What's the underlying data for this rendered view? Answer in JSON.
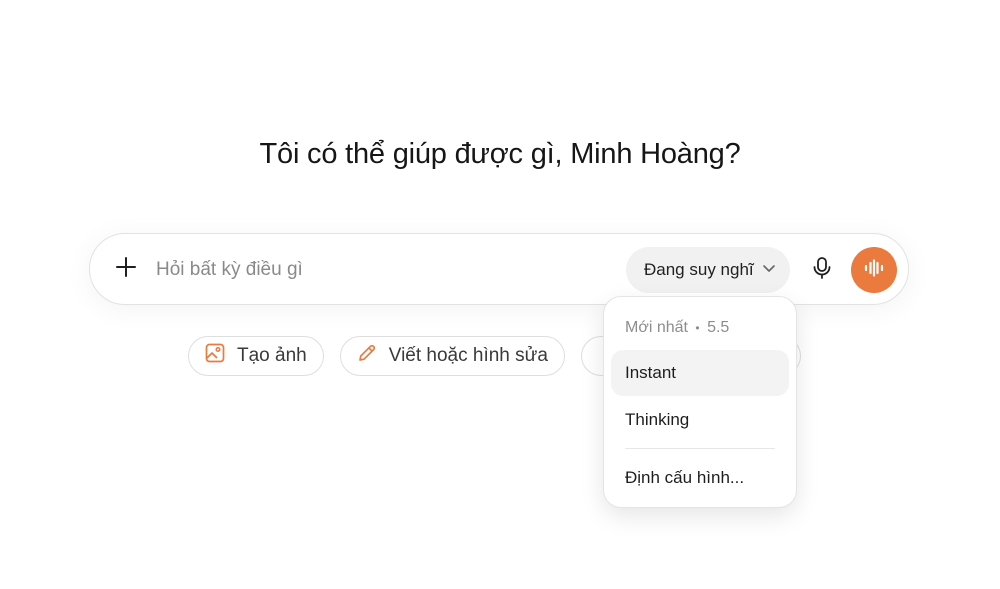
{
  "greeting": "Tôi có thể giúp được gì, Minh Hoàng?",
  "composer": {
    "placeholder": "Hỏi bất kỳ điều gì",
    "add_icon": "plus-icon",
    "model_selector_label": "Đang suy nghĩ",
    "mic_icon": "microphone-icon",
    "voice_icon": "voice-waveform-icon",
    "accent_color": "#ea7a3d"
  },
  "chips": [
    {
      "label": "Tạo ảnh",
      "icon": "image-icon"
    },
    {
      "label": "Viết hoặc hình sửa",
      "icon": "pencil-icon"
    },
    {
      "label": "",
      "icon": ""
    }
  ],
  "model_menu": {
    "header_label": "Mới nhất",
    "header_separator": "•",
    "header_version": "5.5",
    "items": [
      {
        "label": "Instant",
        "highlighted": true
      },
      {
        "label": "Thinking",
        "highlighted": false
      }
    ],
    "configure_label": "Định cấu hình..."
  }
}
